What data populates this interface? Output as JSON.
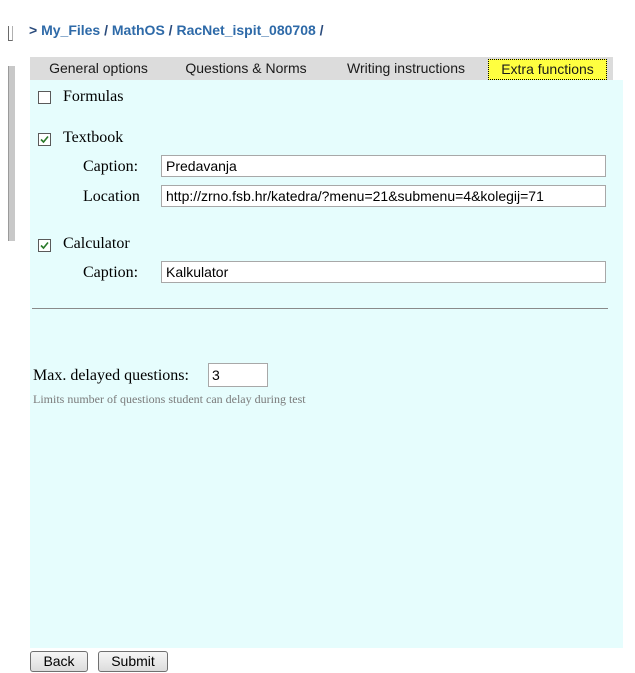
{
  "breadcrumb": {
    "prefix": ">",
    "items": [
      "My_Files",
      "MathOS",
      "RacNet_ispit_080708"
    ],
    "separator": "/"
  },
  "tabs": [
    {
      "label": "General options",
      "active": false
    },
    {
      "label": "Questions & Norms",
      "active": false
    },
    {
      "label": "Writing instructions",
      "active": false
    },
    {
      "label": "Extra functions",
      "active": true
    }
  ],
  "extra": {
    "formulas": {
      "label": "Formulas",
      "checked": false
    },
    "textbook": {
      "label": "Textbook",
      "checked": true,
      "caption_label": "Caption:",
      "caption_value": "Predavanja",
      "location_label": "Location",
      "location_value": "http://zrno.fsb.hr/katedra/?menu=21&submenu=4&kolegij=71"
    },
    "calculator": {
      "label": "Calculator",
      "checked": true,
      "caption_label": "Caption:",
      "caption_value": "Kalkulator"
    },
    "max_delayed": {
      "label": "Max. delayed questions:",
      "value": "3",
      "hint": "Limits number of questions student can delay during test"
    }
  },
  "buttons": {
    "back": "Back",
    "submit": "Submit"
  },
  "colors": {
    "panel_bg": "#e6fdfd",
    "active_tab_bg": "#ffff40",
    "breadcrumb": "#2e6aa8"
  }
}
